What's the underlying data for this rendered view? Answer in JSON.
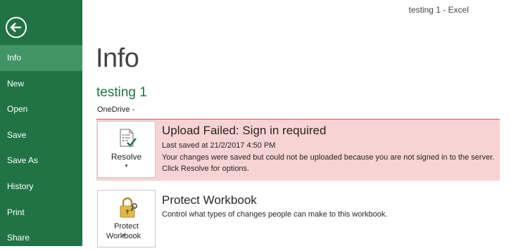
{
  "window": {
    "title": "testing 1 - Excel"
  },
  "sidebar": {
    "back_icon": "back-arrow-icon",
    "items": [
      {
        "label": "Info",
        "active": true
      },
      {
        "label": "New"
      },
      {
        "label": "Open"
      },
      {
        "label": "Save"
      },
      {
        "label": "Save As"
      },
      {
        "label": "History"
      },
      {
        "label": "Print"
      },
      {
        "label": "Share"
      }
    ]
  },
  "main": {
    "page_title": "Info",
    "document_name": "testing 1",
    "location": "OneDrive - "
  },
  "alert": {
    "title": "Upload Failed: Sign in required",
    "last_saved": "Last saved at 21/2/2017 4:50 PM",
    "description": "Your changes were saved but could not be uploaded because you are not signed in to the server. Click Resolve for options.",
    "button_label": "Resolve",
    "button_icon": "document-checklist-icon"
  },
  "protect": {
    "title": "Protect Workbook",
    "description": "Control what types of changes people can make to this workbook.",
    "button_label_line1": "Protect",
    "button_label_line2": "Workbook",
    "button_icon": "lock-key-icon"
  },
  "colors": {
    "sidebar": "#217346",
    "sidebar_active": "#439467",
    "accent_text": "#217346",
    "alert_background": "#f8d3d3"
  }
}
